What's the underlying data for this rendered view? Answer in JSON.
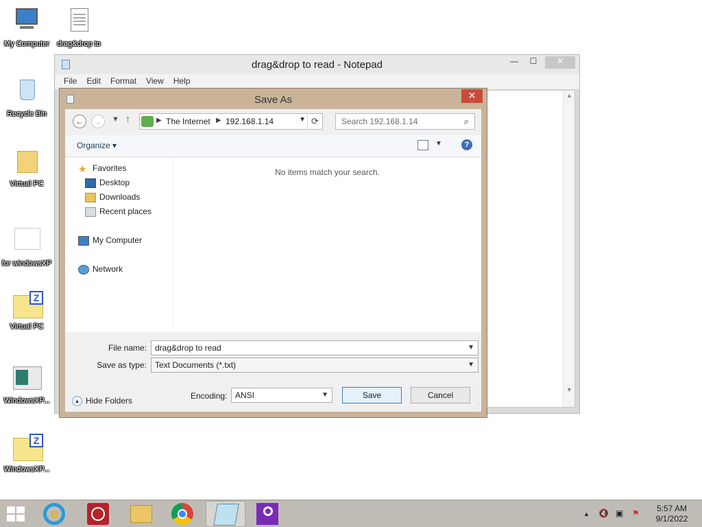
{
  "desktop": {
    "icons": [
      {
        "label": "My Computer"
      },
      {
        "label": "drag&drop to"
      },
      {
        "label": "Recycle Bin"
      },
      {
        "label": "Virtual PC"
      },
      {
        "label": "for windowsXP"
      },
      {
        "label": "Virtual PC"
      },
      {
        "label": "WindowsXP..."
      },
      {
        "label": "WindowsXP..."
      }
    ]
  },
  "notepad": {
    "title": "drag&drop to read - Notepad",
    "menu": [
      "File",
      "Edit",
      "Format",
      "View",
      "Help"
    ],
    "minimize": "—",
    "maximize": "☐",
    "close": "✕"
  },
  "save_dialog": {
    "title": "Save As",
    "close": "✕",
    "breadcrumb": [
      "The Internet",
      "192.168.1.14"
    ],
    "search_placeholder": "Search 192.168.1.14",
    "organize_label": "Organize",
    "nav": {
      "favorites": "Favorites",
      "desktop": "Desktop",
      "downloads": "Downloads",
      "recent": "Recent places",
      "computer": "My Computer",
      "network": "Network"
    },
    "empty_message": "No items match your search.",
    "file_name_label": "File name:",
    "file_name_value": "drag&drop to read",
    "save_type_label": "Save as type:",
    "save_type_value": "Text Documents (*.txt)",
    "encoding_label": "Encoding:",
    "encoding_value": "ANSI",
    "save_button": "Save",
    "cancel_button": "Cancel",
    "hide_folders": "Hide Folders"
  },
  "taskbar": {
    "apps": [
      "internet-explorer",
      "alarm-clock",
      "file-explorer",
      "chrome",
      "notepad",
      "search-app"
    ],
    "time": "5:57 AM",
    "date": "9/1/2022"
  }
}
